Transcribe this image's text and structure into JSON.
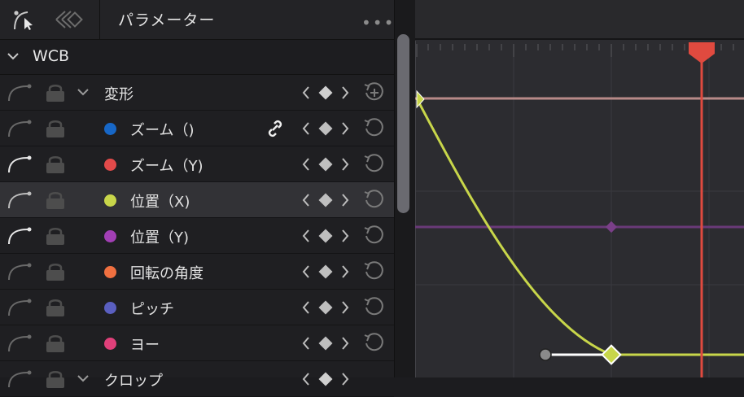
{
  "panel": {
    "title": "パラメーター",
    "more": "•••"
  },
  "section": {
    "name": "WCB"
  },
  "group": {
    "name": "変形"
  },
  "rows": [
    {
      "label": "ズーム（)",
      "color": "#1767c7",
      "has_link": true
    },
    {
      "label": "ズーム（Y)",
      "color": "#e24a4a"
    },
    {
      "label": "位置（X)",
      "color": "#c8d64a",
      "selected": true
    },
    {
      "label": "位置（Y)",
      "color": "#a23fb5"
    },
    {
      "label": "回転の角度",
      "color": "#f07040"
    },
    {
      "label": "ピッチ",
      "color": "#5a5fc0"
    },
    {
      "label": "ヨー",
      "color": "#e0407a"
    }
  ],
  "next_group": {
    "name": "クロップ"
  },
  "colors": {
    "playhead": "#e04a3f",
    "curve": "#c8d64a",
    "purple_line": "#6a3a78",
    "pink_line": "#b78a88"
  }
}
